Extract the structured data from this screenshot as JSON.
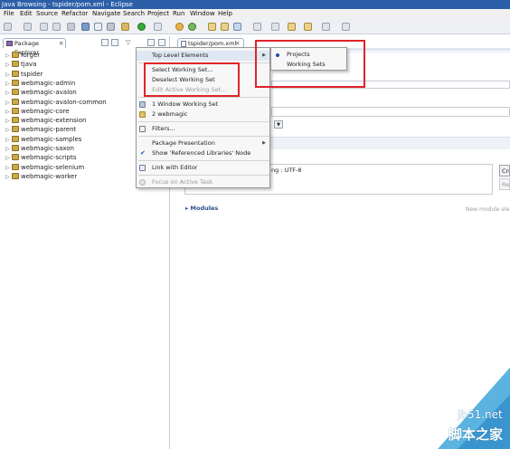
{
  "window": {
    "title": "Java Browsing - tspider/pom.xml - Eclipse"
  },
  "menubar": [
    "File",
    "Edit",
    "Source",
    "Refactor",
    "Navigate",
    "Search",
    "Project",
    "Run",
    "Window",
    "Help"
  ],
  "package_explorer": {
    "tab_label": "Package Explorer",
    "items": [
      "forger",
      "tjava",
      "tspider",
      "webmagic-admin",
      "webmagic-avalon",
      "webmagic-avalon-common",
      "webmagic-core",
      "webmagic-extension",
      "webmagic-parent",
      "webmagic-samples",
      "webmagic-saxon",
      "webmagic-scripts",
      "webmagic-selenium",
      "webmagic-worker"
    ]
  },
  "editor": {
    "tab_label": "tspider/pom.xml",
    "encoding_text": "ng : UTF-8",
    "modules_label": "Modules",
    "new_module_hint": "New module ele",
    "side_btn_1": "Cre",
    "side_btn_2": "Re"
  },
  "context_menu": {
    "top_level": "Top Level Elements",
    "select_ws": "Select Working Set...",
    "deselect_ws": "Deselect Working Set",
    "edit_ws": "Edit Active Working Set...",
    "window_ws": "1 Window Working Set",
    "webmagic": "2 webmagic",
    "filters": "Filters...",
    "pkg_presentation": "Package Presentation",
    "show_ref_libs": "Show 'Referenced Libraries' Node",
    "link_editor": "Link with Editor",
    "focus_task": "Focus on Active Task"
  },
  "submenu": {
    "projects": "Projects",
    "working_sets": "Working Sets",
    "selected": "Projects"
  },
  "watermark": {
    "text": "jb51.net",
    "cn": "脚本之家"
  },
  "colors": {
    "highlight": "#e0242a",
    "title_bg": "#2c5fa8"
  }
}
